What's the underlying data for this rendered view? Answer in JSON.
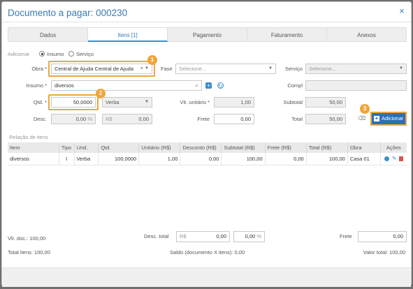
{
  "header": {
    "title": "Documento a pagar: 000230",
    "close_glyph": "×"
  },
  "tabs": [
    "Dados",
    "Itens [1]",
    "Pagamento",
    "Faturamento",
    "Anexos"
  ],
  "form": {
    "adicionar_label": "Adicionar",
    "insumo_option": "Insumo",
    "servico_option": "Serviço",
    "obra_label": "Obra *",
    "obra_value": "Central de Ajuda Central de Ajuda",
    "fase_label": "Fase",
    "fase_placeholder": "Selecione...",
    "servico_label": "Serviço",
    "servico_placeholder": "Selecione...",
    "insumo_label": "Insumo *",
    "insumo_value": "diversos",
    "compl_label": "Compl",
    "qtd_label": "Qtd. *",
    "qtd_value": "50,0000",
    "unidade_value": "Verba",
    "vlr_unitario_label": "Vlr. unitário *",
    "vlr_unitario_value": "1,00",
    "subtotal_label": "Subtotal",
    "subtotal_value": "50,00",
    "desc_label": "Desc.",
    "desc_pct_value": "0,00",
    "desc_pct_symbol": "%",
    "desc_rs_symbol": "R$",
    "desc_rs_value": "0,00",
    "frete_label": "Frete",
    "frete_value": "0,00",
    "total_label": "Total",
    "total_value": "50,00",
    "add_button": "Adicionar"
  },
  "callouts": [
    "1",
    "2",
    "3"
  ],
  "items_section": {
    "label": "Relação de itens",
    "columns": [
      "Item",
      "Tipo",
      "Und.",
      "Qtd.",
      "Unitário (R$)",
      "Desconto (R$)",
      "Subtotal (R$)",
      "Frete (R$)",
      "Total (R$)",
      "Obra",
      "Ações"
    ],
    "rows": [
      [
        "diversos",
        "I",
        "Verba",
        "100,0000",
        "1,00",
        "0,00",
        "100,00",
        "0,00",
        "100,00",
        "Casa 01"
      ]
    ]
  },
  "totals": {
    "vlr_doc": "Vlr. doc.: 100,00",
    "desc_total_label": "Desc. total",
    "desc_total_rs_symbol": "R$",
    "desc_total_rs_value": "0,00",
    "desc_total_pct_value": "0,00",
    "desc_total_pct_symbol": "%",
    "frete_label": "Frete",
    "frete_value": "0,00",
    "total_itens": "Total itens: 100,00",
    "saldo": "Saldo (documento X itens): 0,00",
    "valor_total": "Valor total: 100,00"
  },
  "colors": {
    "accent": "#3a8fd0",
    "callout": "#f0a53a",
    "button": "#2f6fb0"
  }
}
